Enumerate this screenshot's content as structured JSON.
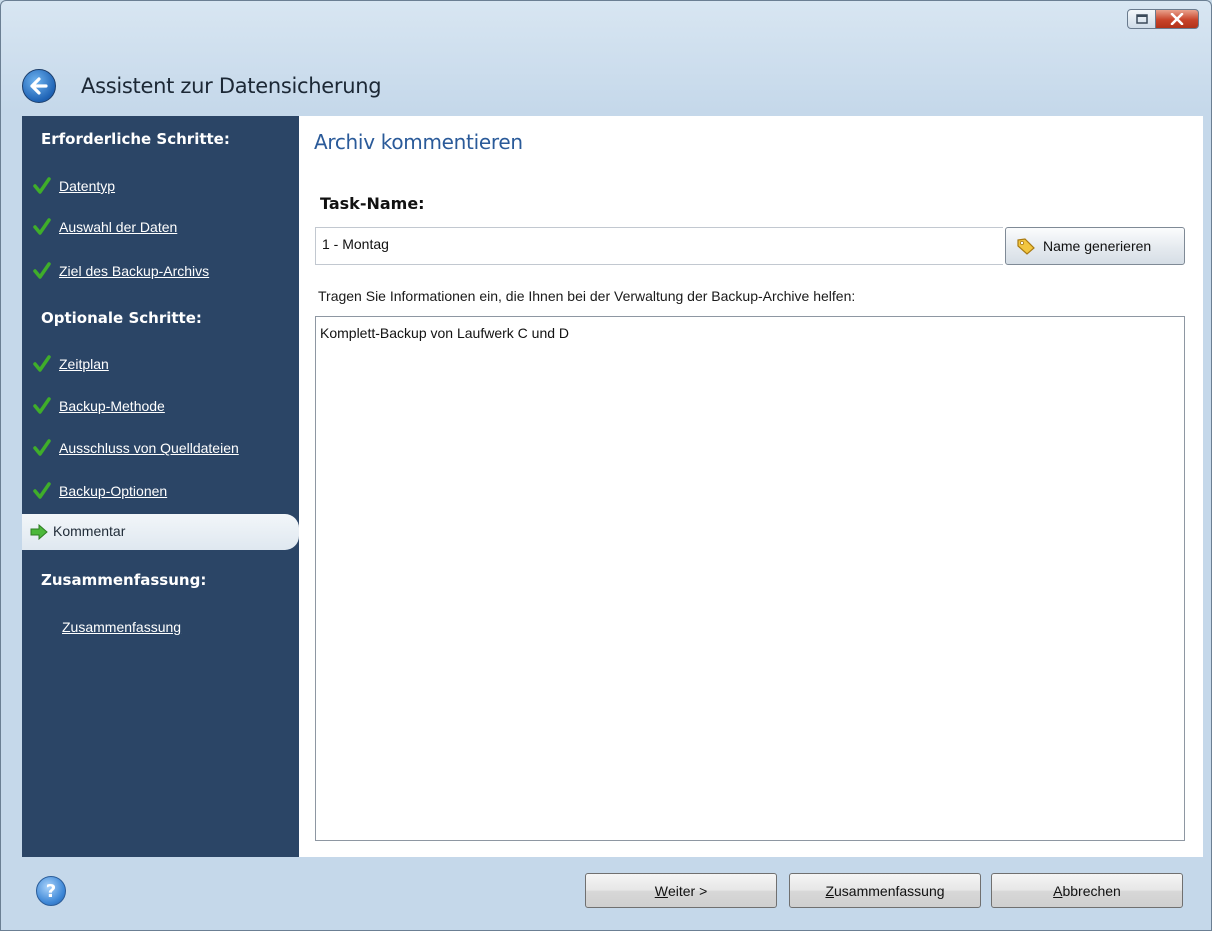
{
  "window": {
    "title": "Assistent zur Datensicherung"
  },
  "sidebar": {
    "required_heading": "Erforderliche Schritte:",
    "required_items": [
      {
        "label": "Datentyp",
        "state": "done"
      },
      {
        "label": "Auswahl der Daten",
        "state": "done"
      },
      {
        "label": "Ziel des Backup-Archivs",
        "state": "done"
      }
    ],
    "optional_heading": "Optionale Schritte:",
    "optional_items": [
      {
        "label": "Zeitplan",
        "state": "done"
      },
      {
        "label": "Backup-Methode",
        "state": "done"
      },
      {
        "label": "Ausschluss von Quelldateien",
        "state": "done"
      },
      {
        "label": "Backup-Optionen",
        "state": "done"
      }
    ],
    "active_item": {
      "label": "Kommentar",
      "state": "current"
    },
    "summary_heading": "Zusammenfassung:",
    "summary_item": {
      "label": "Zusammenfassung"
    }
  },
  "main": {
    "heading": "Archiv kommentieren",
    "task_name_label": "Task-Name:",
    "task_name_value": "1 - Montag",
    "generate_button": "Name generieren",
    "info_text": "Tragen Sie Informationen ein, die Ihnen bei der Verwaltung der Backup-Archive helfen:",
    "comment_value": "Komplett-Backup von Laufwerk C und D"
  },
  "footer": {
    "next_button": {
      "mnemonic": "W",
      "rest": "eiter >"
    },
    "summary_button": {
      "mnemonic": "Z",
      "rest": "usammenfassung"
    },
    "cancel_button": {
      "mnemonic": "A",
      "rest": "bbrechen"
    }
  },
  "icons": {
    "check": "checkmark-icon",
    "current": "arrow-right-icon",
    "back": "back-arrow-icon",
    "help": "help-icon",
    "tag": "tag-icon"
  },
  "colors": {
    "sidebar_bg": "#2b4566",
    "heading_blue": "#2a5a99",
    "check_green": "#3fae2a"
  }
}
